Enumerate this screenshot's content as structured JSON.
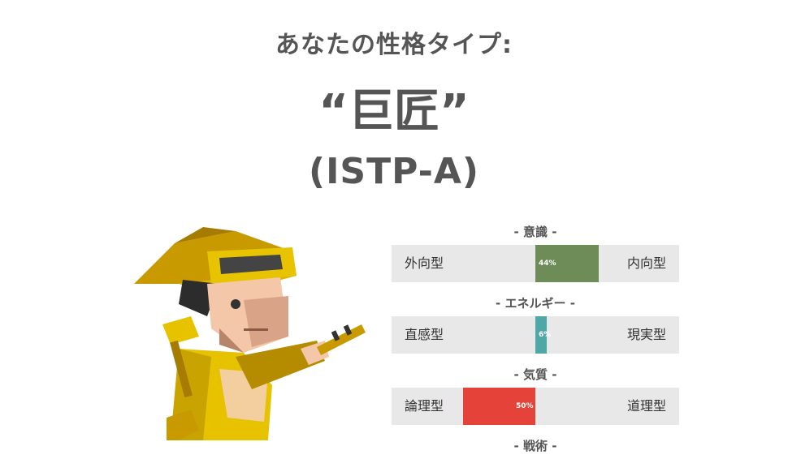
{
  "header": {
    "lead": "あなたの性格タイプ:",
    "type_name": "“巨匠”",
    "type_code": "(ISTP-A)"
  },
  "traits": [
    {
      "title": "- 意識 -",
      "left": "外向型",
      "right": "内向型",
      "percent_label": "44%",
      "value": 44,
      "side": "right",
      "color": "#6e8c57"
    },
    {
      "title": "- エネルギー -",
      "left": "直感型",
      "right": "現実型",
      "percent_label": "6%",
      "value": 6,
      "side": "right",
      "color": "#4ea8a8"
    },
    {
      "title": "- 気質 -",
      "left": "論理型",
      "right": "道理型",
      "percent_label": "50%",
      "value": 50,
      "side": "left",
      "color": "#e5423a"
    },
    {
      "title": "- 戦術 -"
    }
  ],
  "illustration": {
    "icon": "virtuoso-character-icon"
  }
}
